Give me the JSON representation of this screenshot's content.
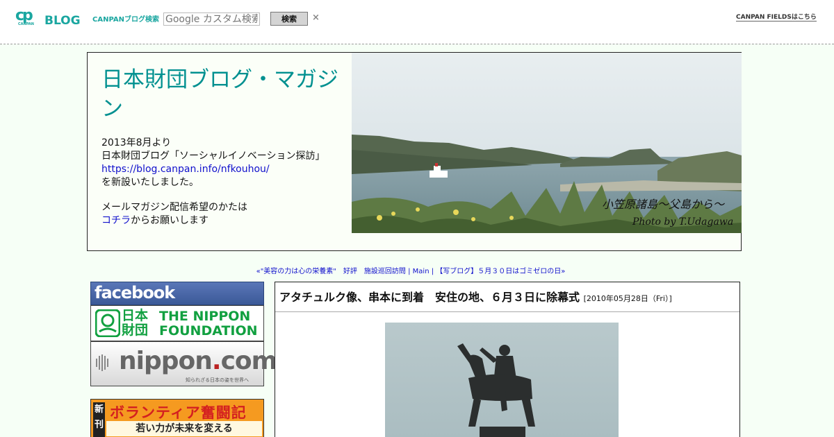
{
  "topbar": {
    "logo_cp": "cp",
    "logo_cp_sub": "CANPAN",
    "logo_blog": "BLOG",
    "search_label": "CANPANブログ検索",
    "search_placeholder": "Google カスタム検索",
    "search_button": "検索",
    "close_symbol": "×",
    "fields_link": "CANPAN FIELDSはこちら"
  },
  "header": {
    "title": "日本財団ブログ・マガジン",
    "desc_line1": "2013年8月より",
    "desc_line2": "日本財団ブログ「ソーシャルイノベーション探訪」",
    "desc_url": "https://blog.canpan.info/nfkouhou/",
    "desc_line3": "を新設いたしました。",
    "desc_line4": "メールマガジン配信希望のかたは",
    "desc_link": "コチラ",
    "desc_line5": "からお願いします",
    "photo_caption": "小笠原諸島～父島から～",
    "photo_credit": "Photo by T.Udagawa"
  },
  "nav": {
    "prev": "«\"美容の力は心の栄養素\"　好評　施設巡回訪問",
    "sep": "|",
    "main": "Main",
    "next": "【写ブログ】５月３０日はゴミゼロの日»"
  },
  "sidebar": {
    "facebook": "facebook",
    "nf_kanji": "日本財団",
    "nf_en_line1": "THE NIPPON",
    "nf_en_line2": "FOUNDATION",
    "ncom_name_a": "nippon",
    "ncom_name_dot": ".",
    "ncom_name_b": "com",
    "ncom_tag": "知られざる日本の姿を世界へ",
    "vol_new_a": "新",
    "vol_new_b": "刊",
    "vol_title": "ボランティア奮闘記",
    "vol_sub": "若い力が未来を変える"
  },
  "article": {
    "title": "アタチュルク像、串本に到着　安住の地、６月３日に除幕式",
    "date": "[2010年05月28日（Fri）]"
  },
  "colors": {
    "accent": "#009090",
    "link": "#1010cc",
    "background": "#f6fff6",
    "facebook": "#3b5998",
    "nippon_foundation": "#11a040",
    "volunteer_bg": "#f59a20"
  }
}
